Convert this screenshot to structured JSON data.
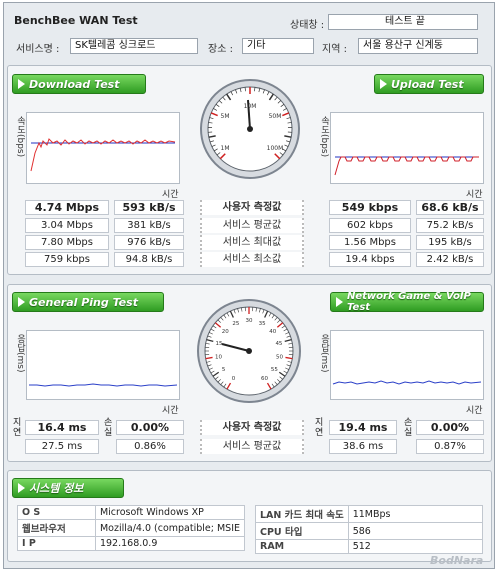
{
  "app": {
    "title": "BenchBee WAN Test"
  },
  "header": {
    "status_label": "상태창 :",
    "status_value": "테스트 끝",
    "service_label": "서비스명 :",
    "service_value": "SK텔레콤 싱크로드",
    "place_label": "장소 :",
    "place_value": "기타",
    "region_label": "지역 :",
    "region_value": "서울 용산구 신계동"
  },
  "speed": {
    "download_button": "Download Test",
    "upload_button": "Upload Test",
    "ylabel": "속도(bps)",
    "xlabel": "시간",
    "rows": [
      {
        "label": "사용자 측정값",
        "dl_bps": "4.74 Mbps",
        "dl_bytes": "593 kB/s",
        "ul_bps": "549 kbps",
        "ul_bytes": "68.6 kB/s"
      },
      {
        "label": "서비스 평균값",
        "dl_bps": "3.04 Mbps",
        "dl_bytes": "381 kB/s",
        "ul_bps": "602 kbps",
        "ul_bytes": "75.2 kB/s"
      },
      {
        "label": "서비스 최대값",
        "dl_bps": "7.80 Mbps",
        "dl_bytes": "976 kB/s",
        "ul_bps": "1.56 Mbps",
        "ul_bytes": "195 kB/s"
      },
      {
        "label": "서비스 최소값",
        "dl_bps": "759 kbps",
        "dl_bytes": "94.8 kB/s",
        "ul_bps": "19.4 kbps",
        "ul_bytes": "2.42 kB/s"
      }
    ],
    "gauge_labels": [
      "1M",
      "5M",
      "10M",
      "50M",
      "100M"
    ]
  },
  "ping": {
    "ping_button": "General Ping Test",
    "voip_button": "Network Game & VoIP Test",
    "ylabel": "응답(ms)",
    "xlabel": "시간",
    "latency_label": "지연",
    "loss_label": "손실",
    "rows": [
      {
        "label": "사용자 측정값",
        "ping_latency": "16.4 ms",
        "ping_loss": "0.00%",
        "voip_latency": "19.4 ms",
        "voip_loss": "0.00%"
      },
      {
        "label": "서비스 평균값",
        "ping_latency": "27.5 ms",
        "ping_loss": "0.86%",
        "voip_latency": "38.6 ms",
        "voip_loss": "0.87%"
      }
    ],
    "gauge_labels": [
      "0",
      "5",
      "10",
      "15",
      "20",
      "25",
      "30",
      "35",
      "40",
      "45",
      "50",
      "55",
      "60"
    ]
  },
  "system": {
    "button": "시스템 정보",
    "left": [
      {
        "k": "O S",
        "v": "Microsoft Windows XP"
      },
      {
        "k": "웹브라우저",
        "v": "Mozilla/4.0 (compatible; MSIE"
      },
      {
        "k": "I P",
        "v": "192.168.0.9"
      }
    ],
    "right": [
      {
        "k": "LAN 카드 최대 속도",
        "v": "11MBps"
      },
      {
        "k": "CPU 타입",
        "v": "586"
      },
      {
        "k": "RAM",
        "v": "512"
      }
    ]
  },
  "watermark": "BodNara",
  "colors": {
    "accent_green": "#3aa12c",
    "download_line": "#e03030",
    "upload_line": "#d0202a",
    "guide_line": "#2030c0",
    "ping_line": "#2a3fc8"
  }
}
